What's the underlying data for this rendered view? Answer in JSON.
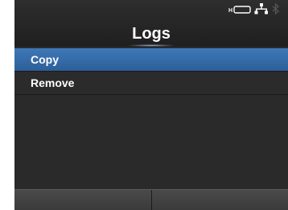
{
  "header": {
    "title": "Logs"
  },
  "status_icons": [
    "sd-card-icon",
    "network-icon",
    "bluetooth-icon"
  ],
  "menu": {
    "items": [
      {
        "label": "Copy",
        "selected": true
      },
      {
        "label": "Remove",
        "selected": false
      }
    ]
  },
  "colors": {
    "accent": "#3e78b8",
    "background": "#2a2a2a",
    "text": "#ffffff"
  }
}
